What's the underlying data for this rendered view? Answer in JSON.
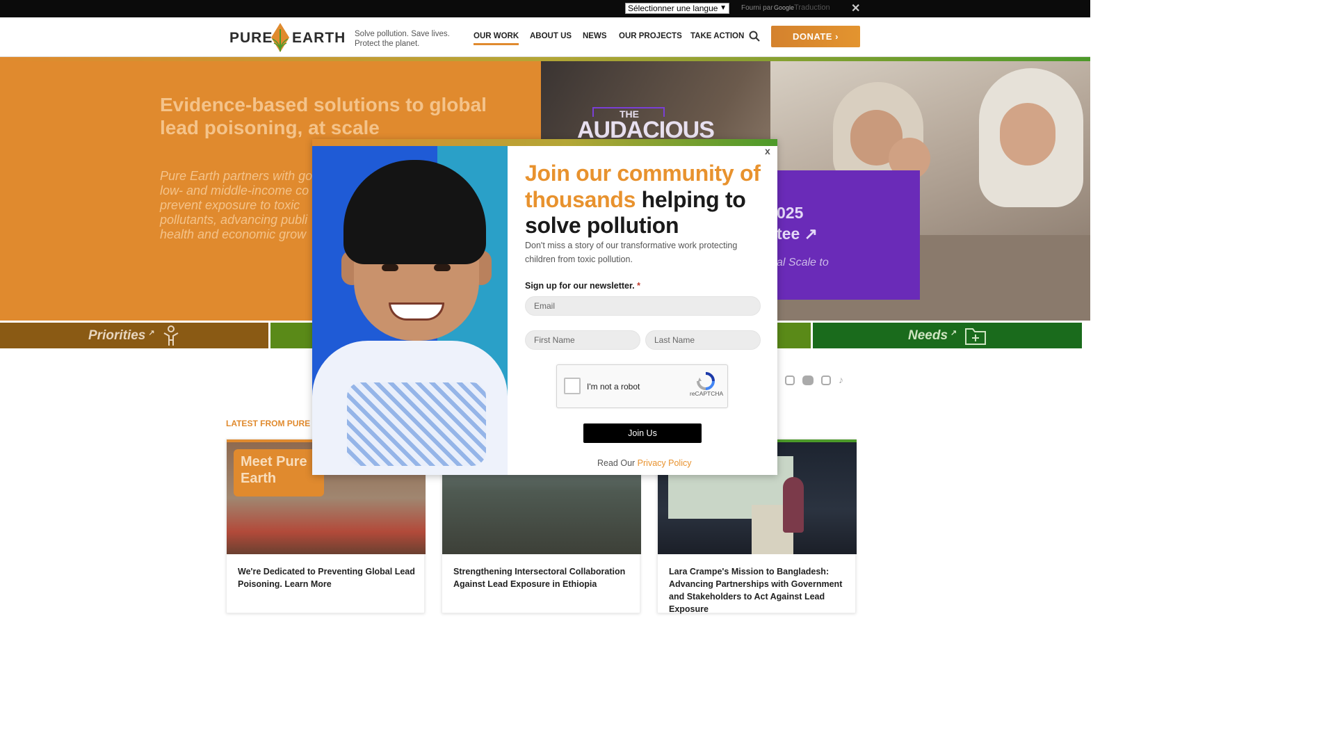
{
  "translate_bar": {
    "select_value": "Sélectionner une langue",
    "provided_by": "Fourni par",
    "google": "Google",
    "translate": "Traduction",
    "close": "✕"
  },
  "header": {
    "logo_word1": "PURE",
    "logo_word2": "EARTH",
    "tagline": "Solve pollution. Save lives. Protect the planet.",
    "nav": [
      "OUR WORK",
      "ABOUT US",
      "NEWS",
      "OUR PROJECTS",
      "TAKE ACTION"
    ],
    "donate_label": "DONATE",
    "donate_chevron": "›"
  },
  "hero": {
    "title": "Evidence-based solutions to global lead poisoning, at scale",
    "text_lines": [
      "Pure Earth partners with go",
      "low- and middle-income co",
      "prevent exposure to toxic",
      "pollutants, advancing publi",
      "health and economic grow"
    ],
    "audacious_small": "THE",
    "audacious_big": "AUDACIOUS",
    "purple_line1": "025",
    "purple_line2": "tee ↗",
    "purple_line3": "al Scale to"
  },
  "tabs": {
    "priorities": "Priorities",
    "needs": "Needs",
    "arrow": "↗"
  },
  "latest": {
    "label": "LATEST FROM PURE E",
    "cards": [
      {
        "title": "We're Dedicated to Preventing Global Lead Poisoning. Learn More",
        "badge": "Meet Pure Earth"
      },
      {
        "title": "Strengthening Intersectoral Collaboration Against Lead Exposure in Ethiopia"
      },
      {
        "title": "Lara Crampe's Mission to Bangladesh: Advancing Partnerships with Government and Stakeholders to Act Against Lead Exposure"
      }
    ]
  },
  "modal": {
    "close": "x",
    "heading_highlight": "Join our community of thousands",
    "heading_rest": " helping to solve pollution",
    "subtext": "Don't miss a story of our transformative work protecting children from toxic pollution.",
    "newsletter_label": "Sign up for our newsletter.",
    "required_mark": "*",
    "email_placeholder": "Email",
    "first_name_placeholder": "First Name",
    "last_name_placeholder": "Last Name",
    "captcha_label": "I'm not a robot",
    "captcha_brand": "reCAPTCHA",
    "join_label": "Join Us",
    "privacy_prefix": "Read Our ",
    "privacy_link": "Privacy Policy"
  },
  "colors": {
    "orange": "#e08a2e",
    "green": "#4c9a2a",
    "purple": "#6a2bb8"
  }
}
